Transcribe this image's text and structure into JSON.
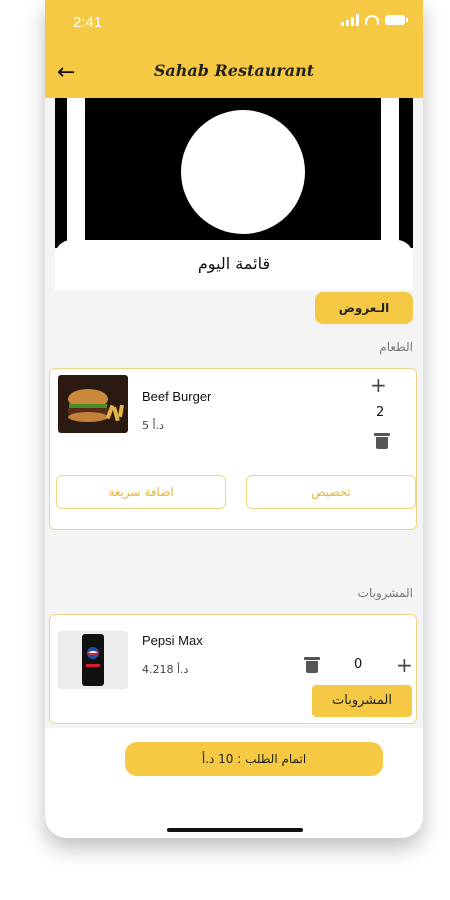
{
  "status": {
    "time": "2:41"
  },
  "header": {
    "title": "Sahab Restaurant"
  },
  "sheet": {
    "title": "قائمة اليوم"
  },
  "offers_label": "الـعروض",
  "sections": {
    "food": "الطعام",
    "drinks": "المشروبات"
  },
  "food_item": {
    "name": "Beef Burger",
    "price": "5 د.أ",
    "quantity": "2",
    "customize_label": "تخصيص",
    "quick_add_label": "اضافة سريعة"
  },
  "drink_item": {
    "name": "Pepsi Max",
    "price": "4.218 د.أ",
    "quantity": "0",
    "drinks_button": "المشروبات"
  },
  "checkout": {
    "label": "اتمام الطلب :  10 د.أ"
  },
  "colors": {
    "accent": "#f6c944",
    "border": "#ecd48a",
    "background": "#f4f4f4"
  },
  "icons": [
    "back-arrow-icon",
    "plus-icon",
    "trash-icon",
    "signal-icon",
    "wifi-icon",
    "battery-icon"
  ]
}
